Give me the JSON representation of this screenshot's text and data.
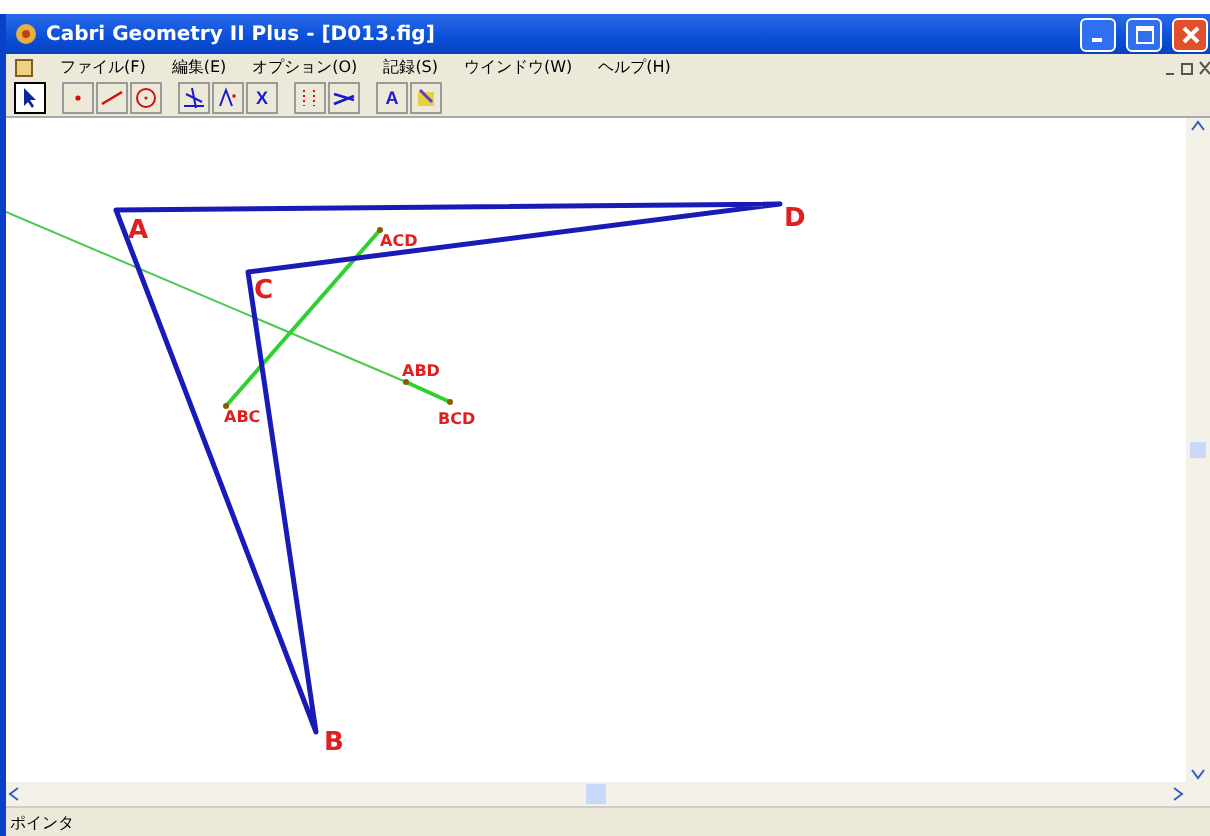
{
  "window": {
    "title": "Cabri Geometry II Plus - [D013.fig]"
  },
  "menu": [
    {
      "label": "ファイル(F)"
    },
    {
      "label": "編集(E)"
    },
    {
      "label": "オプション(O)"
    },
    {
      "label": "記録(S)"
    },
    {
      "label": "ウインドウ(W)"
    },
    {
      "label": "ヘルプ(H)"
    }
  ],
  "toolbar": [
    [
      {
        "kind": "pointer",
        "selected": true
      }
    ],
    [
      {
        "kind": "point",
        "selected": false
      },
      {
        "kind": "line",
        "selected": false
      },
      {
        "kind": "circle",
        "selected": false
      }
    ],
    [
      {
        "kind": "perpendicular",
        "selected": false
      },
      {
        "kind": "symmetry",
        "selected": false
      },
      {
        "kind": "calculate",
        "label": "X",
        "selected": false
      }
    ],
    [
      {
        "kind": "dotted",
        "selected": false
      },
      {
        "kind": "display",
        "selected": false
      }
    ],
    [
      {
        "kind": "text",
        "label": "A",
        "selected": false
      },
      {
        "kind": "paint",
        "selected": false
      }
    ]
  ],
  "canvas": {
    "points": [
      {
        "label": "A",
        "kind": "vertex"
      },
      {
        "label": "B",
        "kind": "vertex"
      },
      {
        "label": "C",
        "kind": "vertex"
      },
      {
        "label": "D",
        "kind": "vertex"
      },
      {
        "label": "ACD",
        "kind": "center"
      },
      {
        "label": "ABC",
        "kind": "center"
      },
      {
        "label": "ABD",
        "kind": "center"
      },
      {
        "label": "BCD",
        "kind": "center"
      }
    ]
  },
  "status_bar": {
    "text": "ポインタ"
  }
}
